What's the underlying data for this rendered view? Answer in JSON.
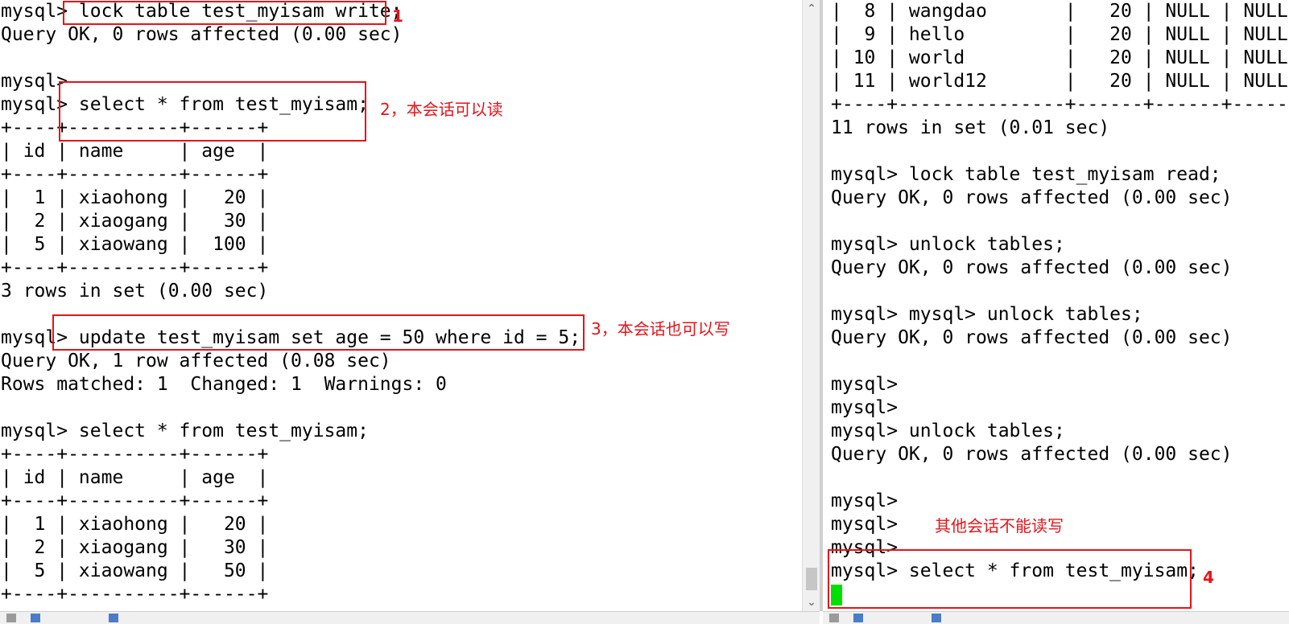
{
  "left_terminal": {
    "lines": [
      "mysql> lock table test_myisam write;",
      "Query OK, 0 rows affected (0.00 sec)",
      "",
      "mysql>",
      "mysql> select * from test_myisam;",
      "+----+----------+------+",
      "| id | name     | age  |",
      "+----+----------+------+",
      "|  1 | xiaohong |   20 |",
      "|  2 | xiaogang |   30 |",
      "|  5 | xiaowang |  100 |",
      "+----+----------+------+",
      "3 rows in set (0.00 sec)",
      "",
      "mysql> update test_myisam set age = 50 where id = 5;",
      "Query OK, 1 row affected (0.08 sec)",
      "Rows matched: 1  Changed: 1  Warnings: 0",
      "",
      "mysql> select * from test_myisam;",
      "+----+----------+------+",
      "| id | name     | age  |",
      "+----+----------+------+",
      "|  1 | xiaohong |   20 |",
      "|  2 | xiaogang |   30 |",
      "|  5 | xiaowang |   50 |",
      "+----+----------+------+"
    ]
  },
  "right_terminal": {
    "lines": [
      "|  8 | wangdao       |   20 | NULL | NULL",
      "|  9 | hello         |   20 | NULL | NULL",
      "| 10 | world         |   20 | NULL | NULL",
      "| 11 | world12       |   20 | NULL | NULL",
      "+----+---------------+------+------+--------",
      "11 rows in set (0.01 sec)",
      "",
      "mysql> lock table test_myisam read;",
      "Query OK, 0 rows affected (0.00 sec)",
      "",
      "mysql> unlock tables;",
      "Query OK, 0 rows affected (0.00 sec)",
      "",
      "mysql> mysql> unlock tables;",
      "Query OK, 0 rows affected (0.00 sec)",
      "",
      "mysql>",
      "mysql>",
      "mysql> unlock tables;",
      "Query OK, 0 rows affected (0.00 sec)",
      "",
      "mysql>",
      "mysql>",
      "mysql>",
      "mysql> select * from test_myisam;"
    ]
  },
  "annotations": {
    "label_1": "1",
    "label_2": "2，本会话可以读",
    "label_3": "3，本会话也可以写",
    "label_4": "4",
    "other_sessions": "其他会话不能读写"
  },
  "colors": {
    "annotation": "#e3141b",
    "cursor": "#00e000"
  },
  "icons": {
    "scroll_up": "chevron-up-icon",
    "scroll_down": "chevron-down-icon"
  }
}
